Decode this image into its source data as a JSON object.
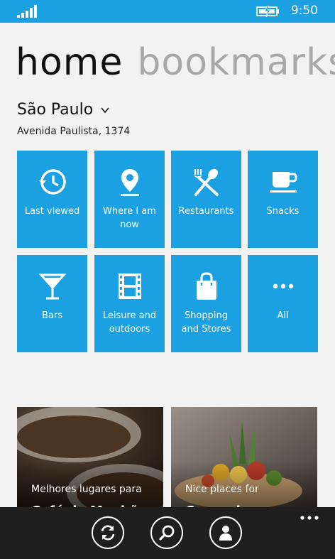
{
  "status_bar": {
    "time": "9:50",
    "signal_icon": "signal-bars-icon",
    "battery_icon": "battery-charging-icon"
  },
  "pivot": {
    "active": "home",
    "next": "bookmarks"
  },
  "location": {
    "city": "São Paulo",
    "address": "Avenida Paulista, 1374"
  },
  "tiles": [
    {
      "label": "Last viewed",
      "icon": "history-clock-icon"
    },
    {
      "label": "Where I am now",
      "icon": "map-pin-icon"
    },
    {
      "label": "Restaurants",
      "icon": "fork-spoon-icon"
    },
    {
      "label": "Snacks",
      "icon": "coffee-cup-icon"
    },
    {
      "label": "Bars",
      "icon": "cocktail-glass-icon"
    },
    {
      "label": "Leisure and outdoors",
      "icon": "film-strip-icon"
    },
    {
      "label": "Shopping and Stores",
      "icon": "shopping-bag-icon"
    },
    {
      "label": "All",
      "icon": "more-dots-icon"
    }
  ],
  "cards": [
    {
      "caption": "Melhores lugares para",
      "title": "Café da Manhã"
    },
    {
      "caption": "Nice places for",
      "title": "Comer bem"
    }
  ],
  "app_bar": {
    "buttons": [
      "refresh-icon",
      "search-icon",
      "profile-icon"
    ],
    "more": "ellipsis-icon"
  },
  "colors": {
    "accent": "#1ba1e2",
    "background": "#f2f2f2",
    "app_bar": "#1f1f1f"
  }
}
